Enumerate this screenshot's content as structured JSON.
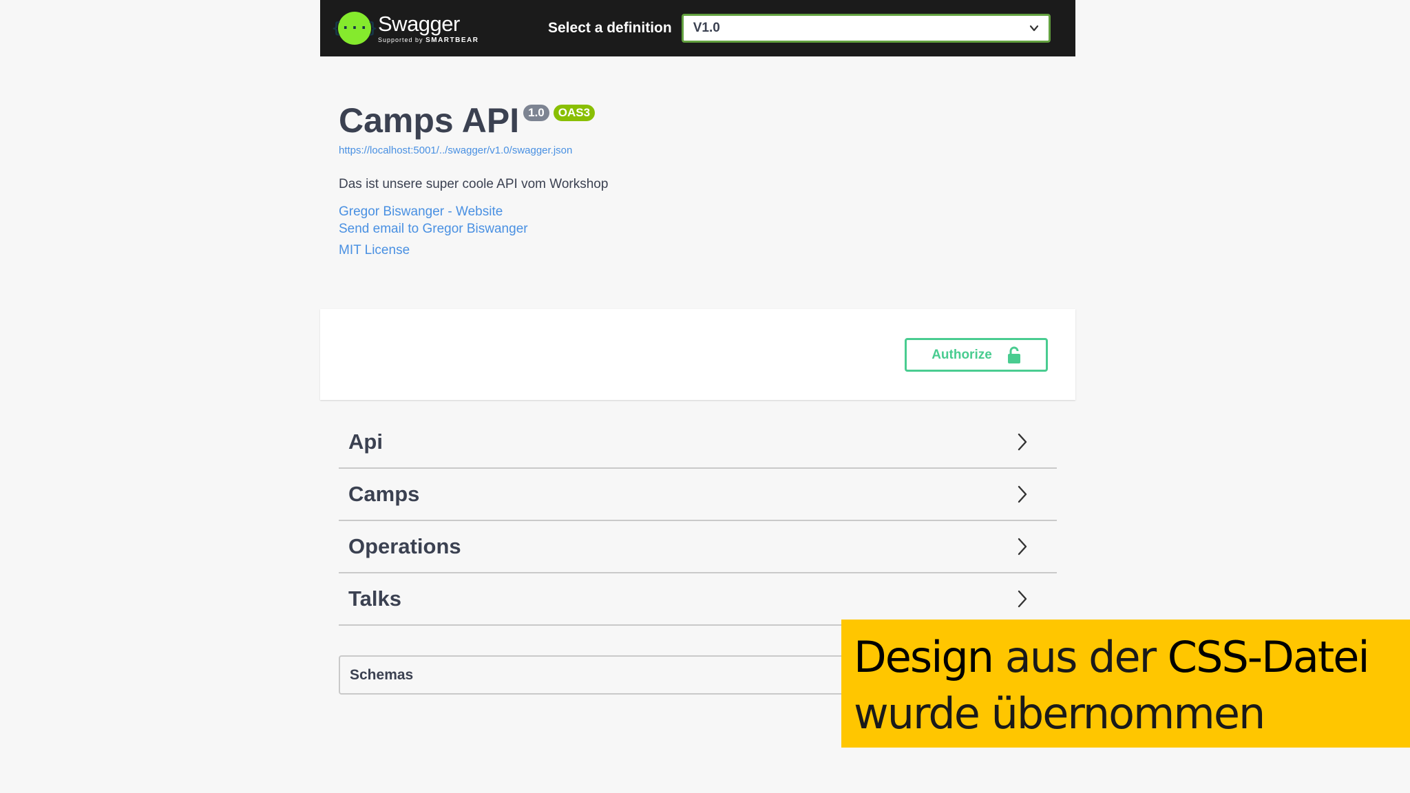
{
  "topbar": {
    "brand_name": "Swagger",
    "brand_sub_prefix": "Supported by",
    "brand_sub_company": "SMARTBEAR",
    "logo_glyph": "{···}",
    "select_label": "Select a definition",
    "select_value": "V1.0"
  },
  "info": {
    "title": "Camps API",
    "version_badge": "1.0",
    "oas_badge": "OAS3",
    "spec_url": "https://localhost:5001/../swagger/v1.0/swagger.json",
    "description": "Das ist unsere super coole API vom Workshop",
    "contact_website": "Gregor Biswanger - Website",
    "contact_email": "Send email to Gregor Biswanger",
    "license": "MIT License"
  },
  "scheme": {
    "authorize_label": "Authorize"
  },
  "tags": [
    {
      "name": "Api"
    },
    {
      "name": "Camps"
    },
    {
      "name": "Operations"
    },
    {
      "name": "Talks"
    }
  ],
  "schemas": {
    "label": "Schemas"
  },
  "caption": {
    "line1_a": "Design",
    "line1_b": " aus der ",
    "line1_c": "CSS-Datei",
    "line2": "wurde übernommen"
  },
  "colors": {
    "topbar_bg": "#1b1b1b",
    "select_border": "#62a03f",
    "logo_green": "#85ea2d",
    "link_blue": "#4990e2",
    "authorize_green": "#49cc90",
    "version_badge": "#7d8492",
    "oas_badge": "#89bf04",
    "caption_bg": "#ffc600"
  },
  "icons": {
    "logo": "swagger-logo-icon",
    "select": "chevron-down-icon",
    "authorize": "lock-icon",
    "tag": "chevron-right-icon"
  }
}
